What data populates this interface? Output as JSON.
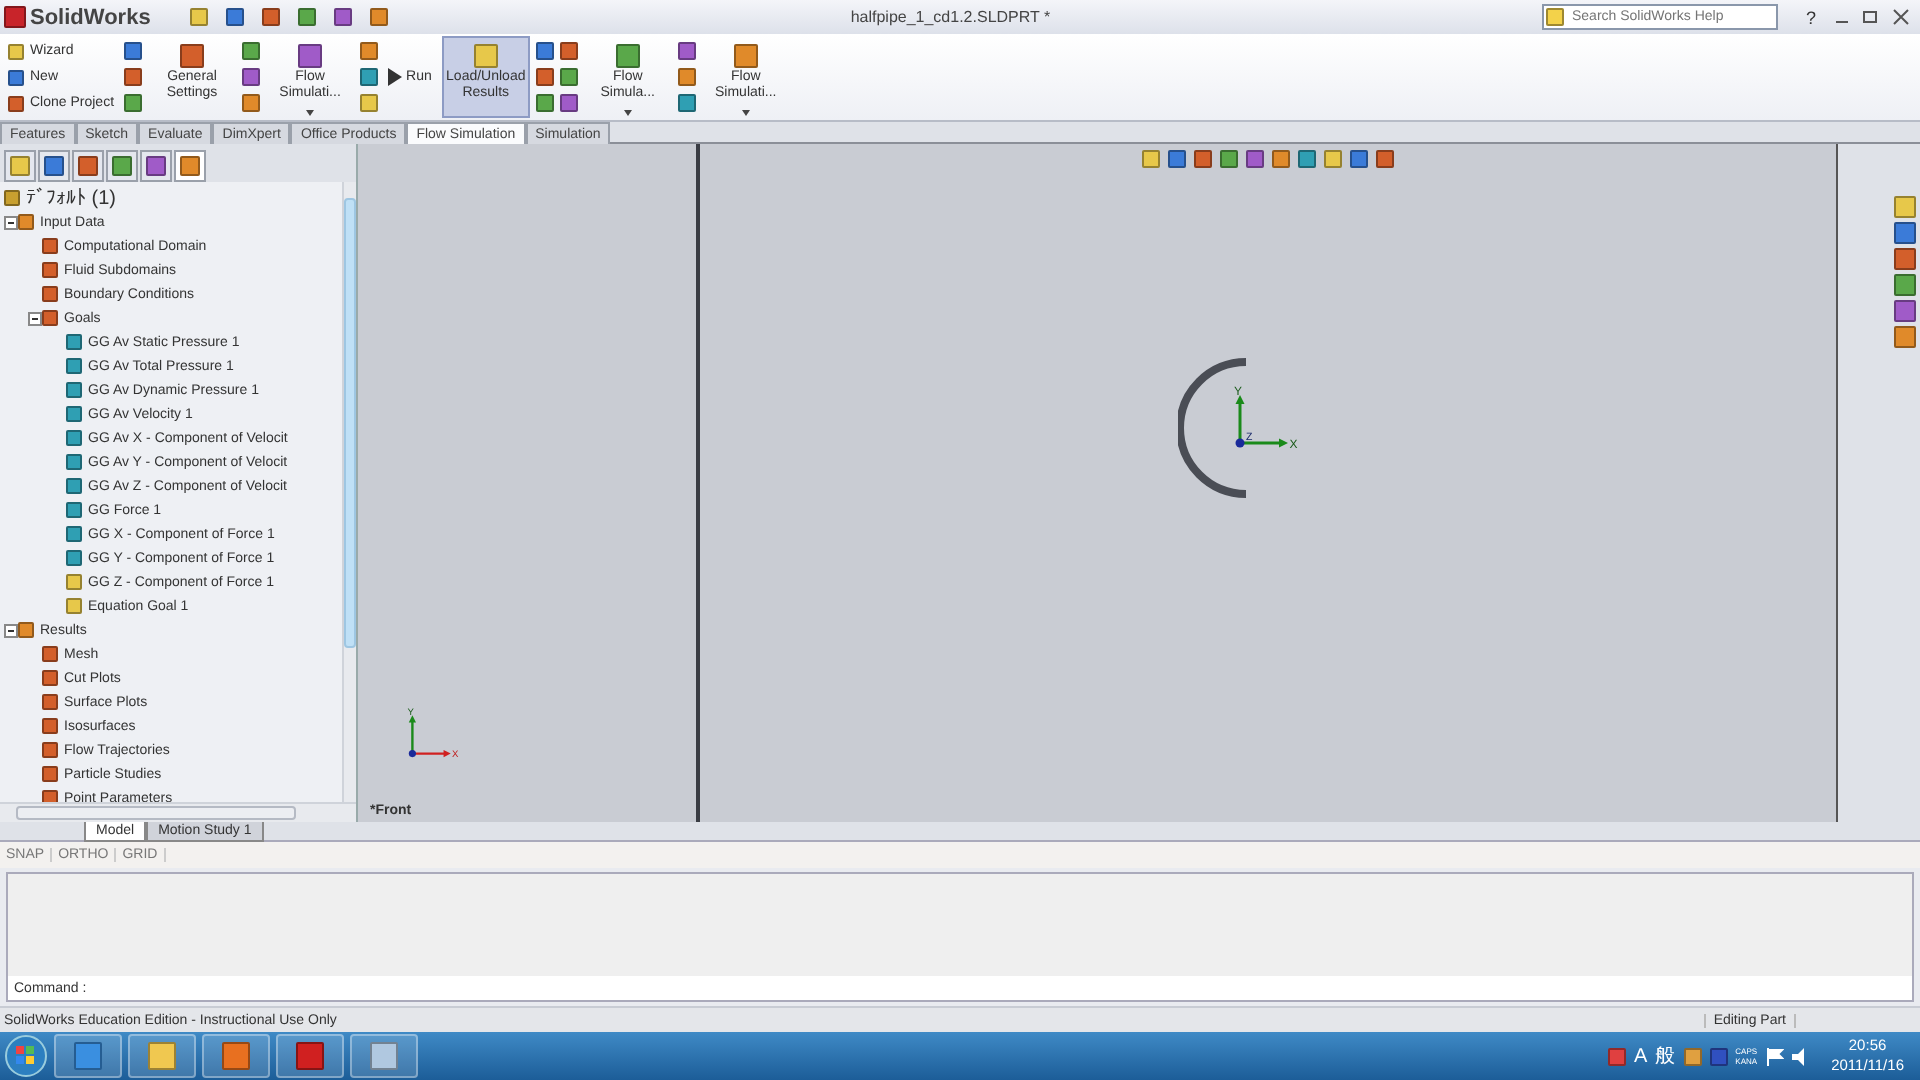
{
  "app": {
    "logo": "SolidWorks",
    "title": "halfpipe_1_cd1.2.SLDPRT *",
    "search": {
      "placeholder": "Search SolidWorks Help"
    },
    "help": "?"
  },
  "ribbon": [
    {
      "kind": "list",
      "labels": [
        "Wizard",
        "New",
        "Clone Project"
      ]
    },
    {
      "kind": "icons"
    },
    {
      "kind": "big",
      "label": "General Settings",
      "selected": false,
      "dropdown": false
    },
    {
      "kind": "icons"
    },
    {
      "kind": "big",
      "label": "Flow Simulati...",
      "selected": false,
      "dropdown": true
    },
    {
      "kind": "icons"
    },
    {
      "kind": "side",
      "label": "Run",
      "selected": false
    },
    {
      "kind": "big",
      "label": "Load/Unload Results",
      "selected": true,
      "dropdown": false
    },
    {
      "kind": "icons"
    },
    {
      "kind": "icons"
    },
    {
      "kind": "big",
      "label": "Flow Simula...",
      "selected": false,
      "dropdown": true
    },
    {
      "kind": "icons"
    },
    {
      "kind": "big",
      "label": "Flow Simulati...",
      "selected": false,
      "dropdown": true
    }
  ],
  "command_tabs": [
    {
      "label": "Features",
      "selected": false
    },
    {
      "label": "Sketch",
      "selected": false
    },
    {
      "label": "Evaluate",
      "selected": false
    },
    {
      "label": "DimXpert",
      "selected": false
    },
    {
      "label": "Office Products",
      "selected": false
    },
    {
      "label": "Flow Simulation",
      "selected": true
    },
    {
      "label": "Simulation",
      "selected": false
    }
  ],
  "panel_tabs": [
    {
      "selected": false
    },
    {
      "selected": false
    },
    {
      "selected": false
    },
    {
      "selected": false
    },
    {
      "selected": false
    },
    {
      "selected": true
    }
  ],
  "tree": {
    "root": "ﾃﾞﾌｫﾙﾄ (1)",
    "items": [
      {
        "label": "Input Data",
        "expanded": true,
        "children": [
          {
            "label": "Computational Domain"
          },
          {
            "label": "Fluid Subdomains"
          },
          {
            "label": "Boundary Conditions"
          },
          {
            "label": "Goals",
            "expanded": true,
            "children": [
              {
                "label": "GG Av Static Pressure 1"
              },
              {
                "label": "GG Av Total Pressure 1"
              },
              {
                "label": "GG Av Dynamic Pressure 1"
              },
              {
                "label": "GG Av Velocity 1"
              },
              {
                "label": "GG Av X - Component of Velocit"
              },
              {
                "label": "GG Av Y - Component of Velocit"
              },
              {
                "label": "GG Av Z - Component of Velocit"
              },
              {
                "label": "GG Force 1"
              },
              {
                "label": "GG X - Component of Force 1"
              },
              {
                "label": "GG Y - Component of Force 1"
              },
              {
                "label": "GG Z - Component of Force 1"
              },
              {
                "label": "Equation Goal 1"
              }
            ]
          }
        ]
      },
      {
        "label": "Results",
        "expanded": true,
        "children": [
          {
            "label": "Mesh"
          },
          {
            "label": "Cut Plots"
          },
          {
            "label": "Surface Plots"
          },
          {
            "label": "Isosurfaces"
          },
          {
            "label": "Flow Trajectories"
          },
          {
            "label": "Particle Studies"
          },
          {
            "label": "Point Parameters"
          }
        ]
      }
    ]
  },
  "side_view": {
    "label": "*Front",
    "axes": [
      "Y",
      "X"
    ]
  },
  "main_view": {
    "axes": [
      "Y",
      "X",
      "Z"
    ]
  },
  "bottom_tabs": [
    {
      "label": "Model",
      "selected": true
    },
    {
      "label": "Motion Study 1",
      "selected": false
    }
  ],
  "snap_bar": [
    "SNAP",
    "ORTHO",
    "GRID"
  ],
  "command": {
    "label": "Command :"
  },
  "status_bar": {
    "text": "SolidWorks Education Edition - Instructional Use Only",
    "mode": "Editing Part"
  },
  "taskbar": {
    "ime": [
      "A",
      "般"
    ],
    "keys": [
      "CAPS",
      "KANA"
    ],
    "time": "20:56",
    "date": "2011/11/16"
  }
}
